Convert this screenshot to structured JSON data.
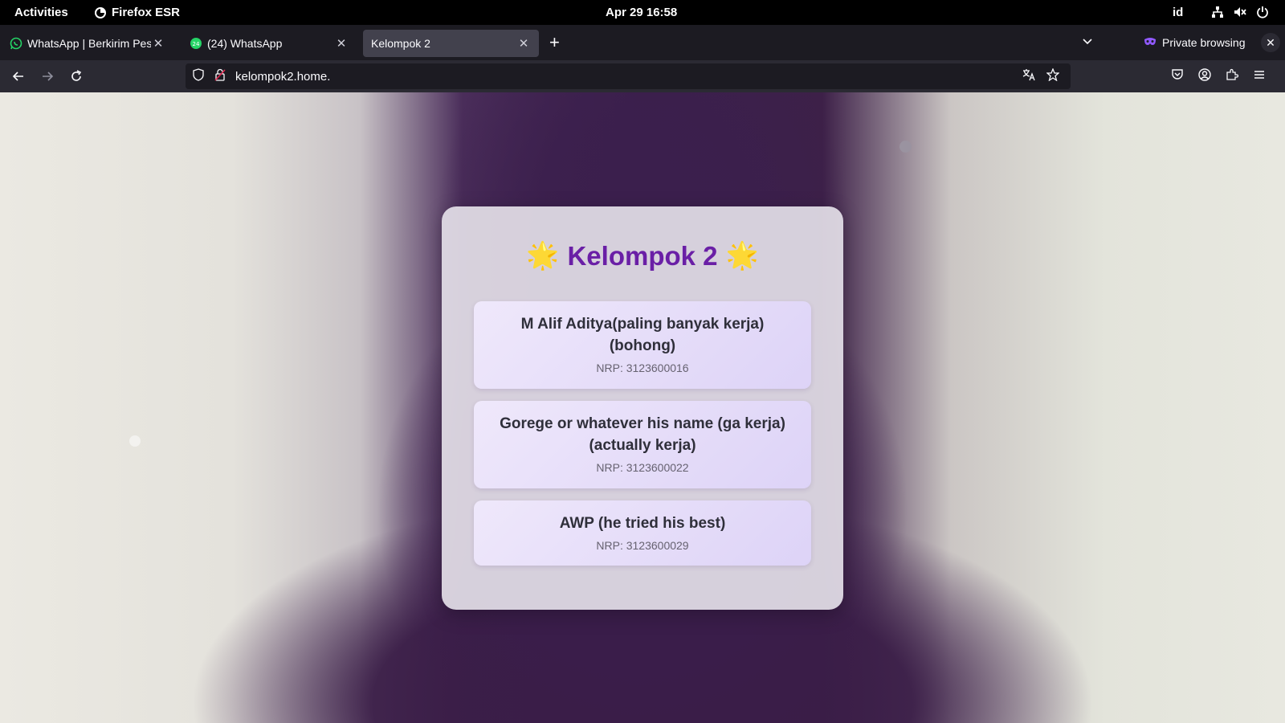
{
  "system_bar": {
    "activities": "Activities",
    "app_name": "Firefox ESR",
    "clock": "Apr 29  16:58",
    "language": "id"
  },
  "tabs": [
    {
      "title": "WhatsApp | Berkirim Pesan",
      "icon": "whatsapp-icon",
      "active": false
    },
    {
      "title": "(24) WhatsApp",
      "icon": "whatsapp-badge-icon",
      "badge": "24",
      "active": false
    },
    {
      "title": "Kelompok 2",
      "icon": "",
      "active": true
    }
  ],
  "private_browsing": "Private browsing",
  "url": "kelompok2.home.",
  "page": {
    "title": "Kelompok 2",
    "title_emoji": "🌟",
    "members": [
      {
        "name": "M Alif Aditya(paling banyak kerja)(bohong)",
        "nrp": "NRP: 3123600016"
      },
      {
        "name": "Gorege or whatever his name (ga kerja)(actually kerja)",
        "nrp": "NRP: 3123600022"
      },
      {
        "name": "AWP (he tried his best)",
        "nrp": "NRP: 3123600029"
      }
    ]
  },
  "colors": {
    "title": "#6a1fa6",
    "whatsapp": "#25d366",
    "private": "#9059ff"
  }
}
